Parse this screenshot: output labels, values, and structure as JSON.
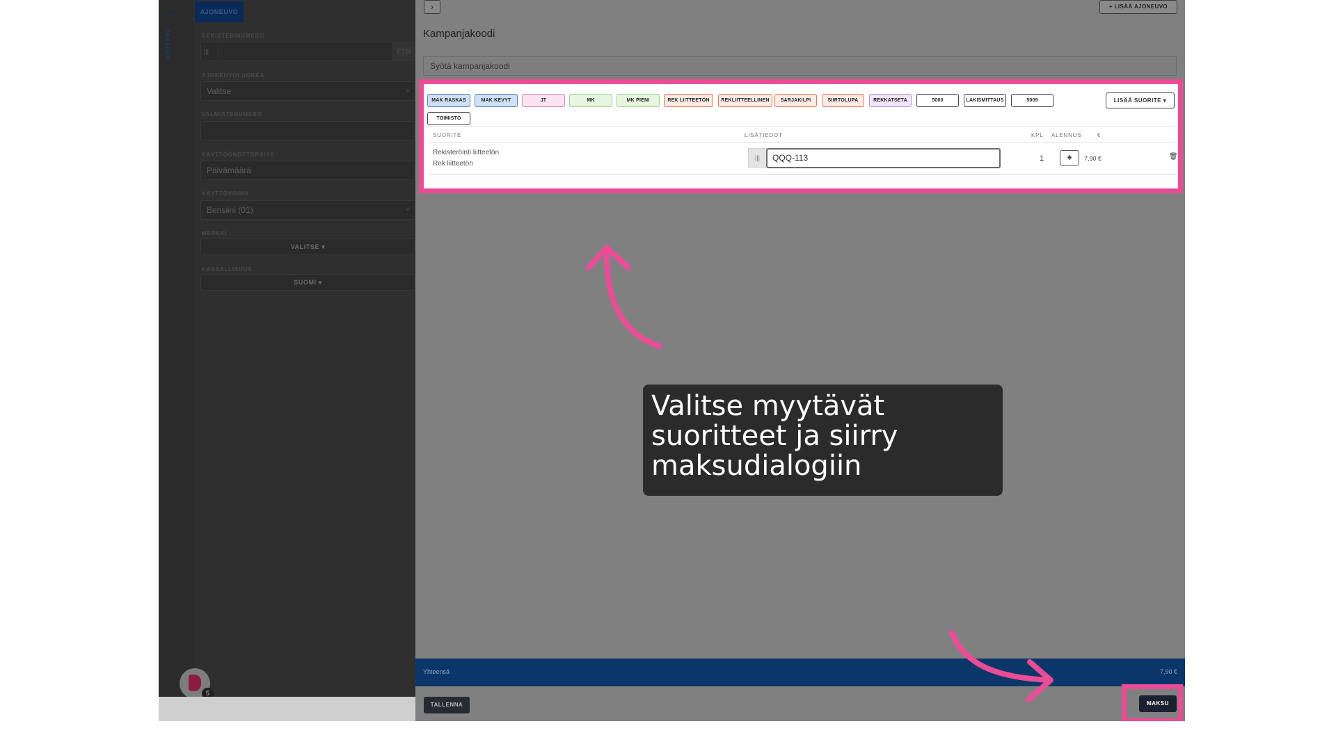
{
  "sidebar": {
    "back_label": "TAKAISIN",
    "vehicle_tab": "AJONEUVO",
    "fields": [
      {
        "label": "REKISTERINUMERO",
        "value": "",
        "button": "ETSI"
      },
      {
        "label": "AJONEUVOLUOKKA",
        "value": "Valitse"
      },
      {
        "label": "VALMISTENUMERO",
        "value": ""
      },
      {
        "label": "KÄYTTÖÖNOTTOPÄIVÄ",
        "value": "Päivämäärä"
      },
      {
        "label": "KÄYTTÖVOIMA",
        "value": "Bensiini (01)"
      },
      {
        "label": "MERKKI",
        "value": "VALITSE ▾"
      },
      {
        "label": "KANSALLISUUS",
        "value": "SUOMI ▾"
      }
    ],
    "badge_count": "5"
  },
  "header": {
    "add_vehicle": "+ LISÄÄ AJONEUVO"
  },
  "campaign": {
    "title": "Kampanjakoodi",
    "placeholder": "Syötä kampanjakoodi"
  },
  "service_chips": [
    {
      "label": "MAK RASKAS",
      "bg": "#cfe0f5",
      "border": "#5a82b8"
    },
    {
      "label": "MAK KEVYT",
      "bg": "#cfe0f5",
      "border": "#5a82b8"
    },
    {
      "label": "JT",
      "bg": "#fbe3ef",
      "border": "#d98ab1"
    },
    {
      "label": "MK",
      "bg": "#e6f6e0",
      "border": "#9fd08c"
    },
    {
      "label": "MK PIENI",
      "bg": "#e6f6e0",
      "border": "#9fd08c"
    },
    {
      "label": "REK LIITTEETÖN",
      "bg": "#fdebe4",
      "border": "#e07a5a"
    },
    {
      "label": "REKLIITTEELLINEN",
      "bg": "#fdebe4",
      "border": "#e07a5a"
    },
    {
      "label": "SARJAKILPI",
      "bg": "#fdebe4",
      "border": "#e07a5a"
    },
    {
      "label": "SIIRTOLUPA",
      "bg": "#fdebe4",
      "border": "#e07a5a"
    },
    {
      "label": "REKKATSETA",
      "bg": "#f1e6fb",
      "border": "#b493d8"
    },
    {
      "label": "5000",
      "bg": "#ffffff",
      "border": "#444444"
    },
    {
      "label": "LAKISMITTAUS",
      "bg": "#ffffff",
      "border": "#444444"
    },
    {
      "label": "5009",
      "bg": "#ffffff",
      "border": "#444444"
    },
    {
      "label": "TOIMISTO",
      "bg": "#ffffff",
      "border": "#444444"
    }
  ],
  "more_services": "LISÄÄ SUORITE ▾",
  "table": {
    "columns": [
      "SUORITE",
      "LISÄTIEDOT",
      "KPL",
      "ALENNUS",
      "€"
    ],
    "rows": [
      {
        "name": "Rekisteröinti liitteetön",
        "subname": "Rek liitteetön",
        "extra": "QQQ-113",
        "qty": "1",
        "price": "7,90 €"
      }
    ]
  },
  "footer": {
    "total_label": "Yhteensä",
    "total_value": "7,90 €",
    "save": "TALLENNA",
    "pay": "MAKSU"
  },
  "callout": {
    "text": "Valitse myytävät suoritteet ja siirry maksudialogiin"
  },
  "colors": {
    "highlight": "#ea4c96",
    "total_bar": "#0b3669",
    "callout_bg": "#2b2b2b"
  }
}
